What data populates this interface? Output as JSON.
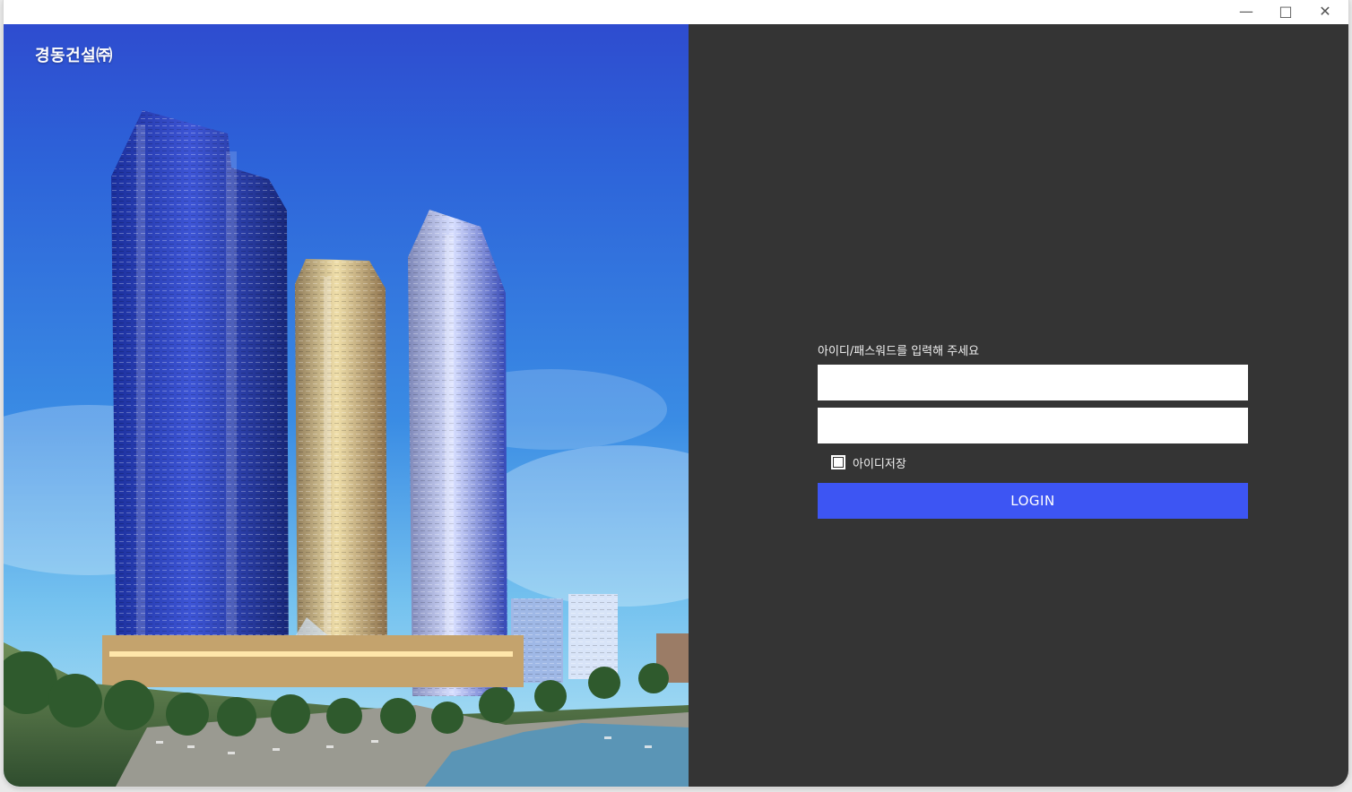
{
  "window": {
    "controls": {
      "minimize": "—",
      "maximize": "□",
      "close": "✕"
    }
  },
  "hero": {
    "company_name": "경동건설㈜",
    "image_semantic": "building-complex-image"
  },
  "login": {
    "instruction": "아이디/패스워드를 입력해 주세요",
    "username_value": "",
    "username_placeholder": "",
    "password_value": "",
    "password_placeholder": "",
    "remember_id_label": "아이디저장",
    "remember_id_checked": true,
    "submit_label": "LOGIN"
  },
  "colors": {
    "panel_background": "#343434",
    "button_accent": "#3d55f3",
    "input_background": "#ffffff"
  }
}
